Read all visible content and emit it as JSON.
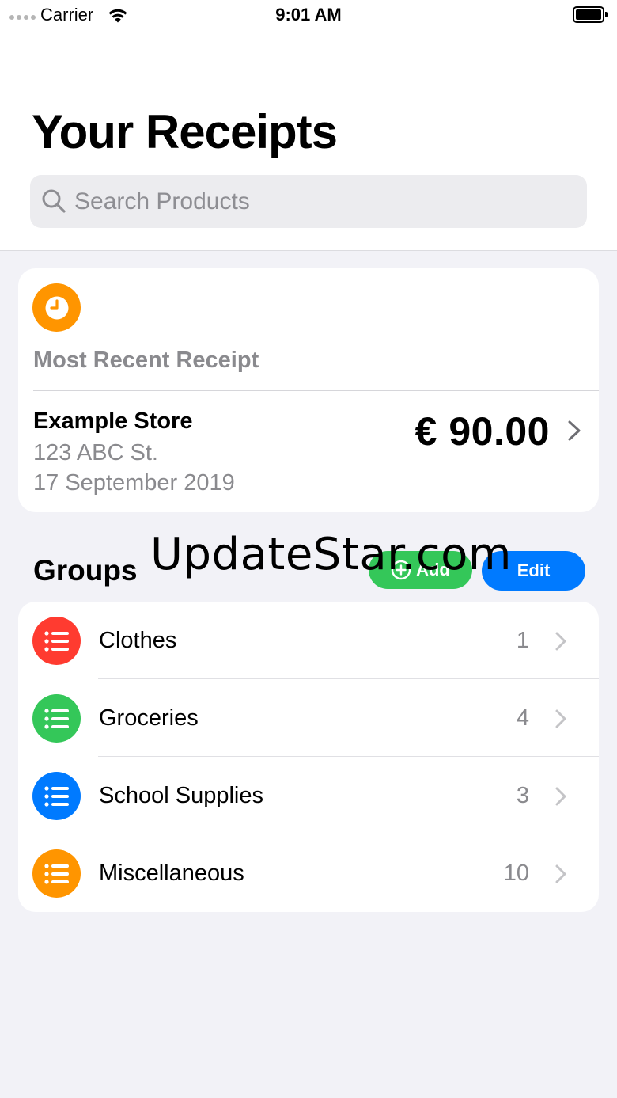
{
  "status_bar": {
    "carrier": "Carrier",
    "time": "9:01 AM"
  },
  "header": {
    "title": "Your Receipts"
  },
  "search": {
    "placeholder": "Search Products",
    "value": ""
  },
  "recent_receipt": {
    "label": "Most Recent Receipt",
    "icon": "clock-icon",
    "store": "Example Store",
    "address": "123 ABC St.",
    "date": "17 September 2019",
    "total": "€ 90.00",
    "badge_color": "#ff9500"
  },
  "groups": {
    "title": "Groups",
    "add_label": "Add",
    "edit_label": "Edit",
    "items": [
      {
        "name": "Clothes",
        "count": "1",
        "color": "#ff3b30",
        "icon": "list-icon"
      },
      {
        "name": "Groceries",
        "count": "4",
        "color": "#34c759",
        "icon": "list-icon"
      },
      {
        "name": "School Supplies",
        "count": "3",
        "color": "#007aff",
        "icon": "list-icon"
      },
      {
        "name": "Miscellaneous",
        "count": "10",
        "color": "#ff9500",
        "icon": "list-icon"
      }
    ]
  },
  "watermark": {
    "text": "UpdateStar.com"
  },
  "colors": {
    "accent_blue": "#007aff",
    "accent_green": "#34c759",
    "background": "#f2f2f7"
  }
}
